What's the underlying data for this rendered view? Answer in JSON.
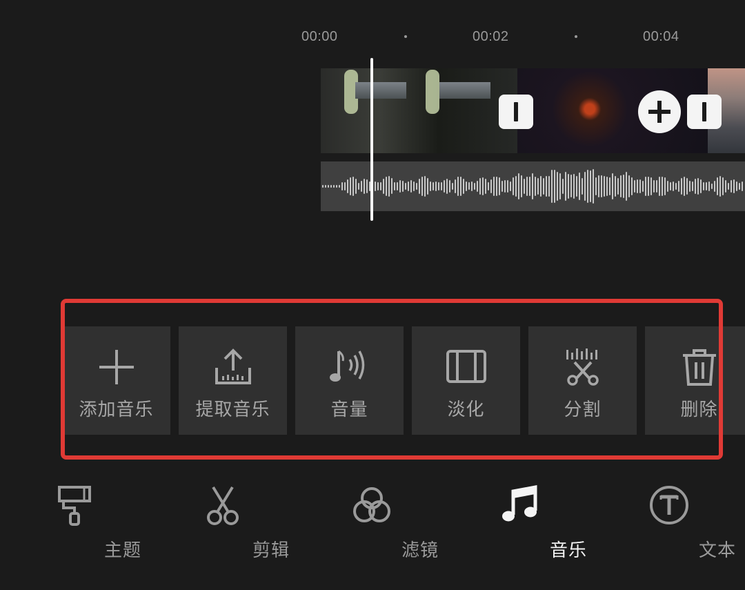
{
  "timeline": {
    "ruler": [
      "00:00",
      "00:02",
      "00:04"
    ]
  },
  "tools": [
    {
      "label": "添加音乐",
      "icon": "plus-icon"
    },
    {
      "label": "提取音乐",
      "icon": "upload-icon"
    },
    {
      "label": "音量",
      "icon": "volume-icon"
    },
    {
      "label": "淡化",
      "icon": "fade-icon"
    },
    {
      "label": "分割",
      "icon": "split-icon"
    },
    {
      "label": "删除",
      "icon": "trash-icon"
    }
  ],
  "nav": [
    {
      "label": "主题",
      "icon": "brush-icon"
    },
    {
      "label": "剪辑",
      "icon": "scissors-icon"
    },
    {
      "label": "滤镜",
      "icon": "filter-icon"
    },
    {
      "label": "音乐",
      "icon": "music-icon",
      "active": true
    },
    {
      "label": "文本",
      "icon": "text-icon"
    }
  ],
  "colors": {
    "background": "#1b1b1b",
    "highlight": "#e03a35",
    "active": "#f4f4f4",
    "inactive": "#9a9a9a"
  }
}
